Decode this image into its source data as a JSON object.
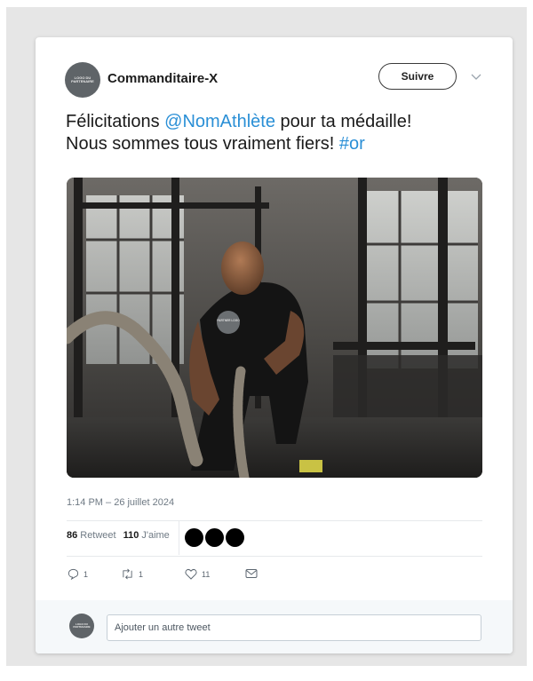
{
  "header": {
    "avatar_text": "LOGO DU PARTENAIRE",
    "account_name": "Commanditaire-X",
    "follow_label": "Suivre"
  },
  "tweet": {
    "text_1": "Félicitations ",
    "mention": "@NomAthlète",
    "text_2": " pour ta médaille!",
    "text_3": "Nous sommes tous vraiment fiers! ",
    "hashtag": "#or"
  },
  "photo": {
    "shirt_badge_text": "PARTNER LOGO"
  },
  "meta": {
    "timestamp": "1:14 PM – 26 juillet 2024"
  },
  "stats": {
    "retweets_count": "86",
    "retweets_label": "Retweet",
    "likes_count": "110",
    "likes_label": "J'aime"
  },
  "actions": {
    "reply_count": "1",
    "retweet_count": "1",
    "like_count": "11"
  },
  "reply": {
    "placeholder": "Ajouter un autre tweet"
  },
  "colors": {
    "link": "#2a8fd6",
    "muted": "#6f7a84",
    "footer_bg": "#f5f8fa"
  }
}
